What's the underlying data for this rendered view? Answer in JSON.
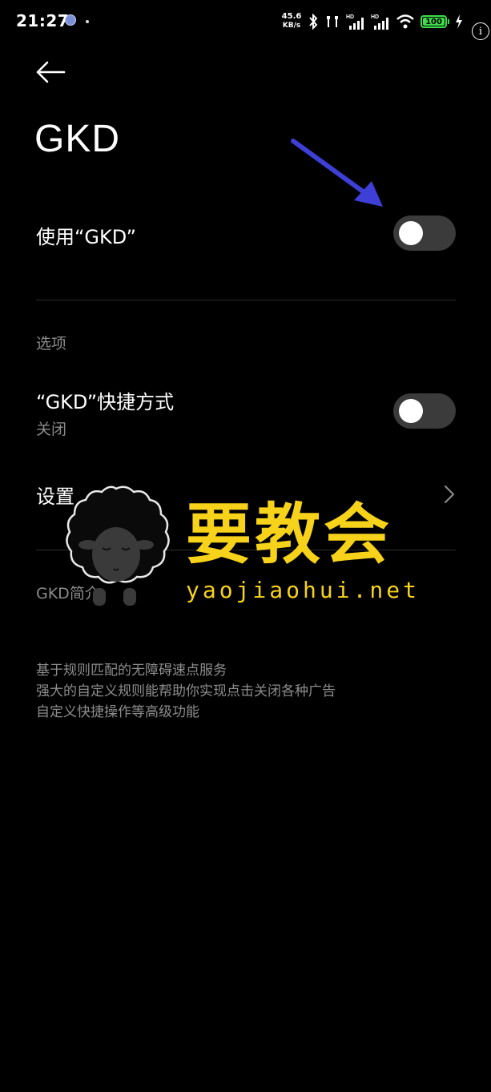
{
  "status_bar": {
    "time": "21:27",
    "net_speed_value": "45.6",
    "net_speed_unit": "KB/s",
    "battery": "100",
    "icons": [
      "bluetooth-icon",
      "earbuds-icon",
      "signal-hd-icon",
      "signal-hd-icon",
      "wifi-icon",
      "battery-icon",
      "charging-icon"
    ]
  },
  "header": {
    "back_icon": "arrow-left-icon",
    "title": "GKD"
  },
  "settings": {
    "use_gkd": {
      "label": "使用“GKD”",
      "enabled": false
    },
    "options_header": "选项",
    "shortcut": {
      "label": "“GKD”快捷方式",
      "status": "关闭",
      "enabled": false
    },
    "settings_item": {
      "label": "设置"
    },
    "intro_header": "GKD简介"
  },
  "description": [
    "基于规则匹配的无障碍速点服务",
    "强大的自定义规则能帮助你实现点击关闭各种广告",
    "自定义快捷操作等高级功能"
  ],
  "watermark": {
    "title": "要教会",
    "url": "yaojiaohui.net"
  },
  "colors": {
    "background": "#000000",
    "toggle_off": "#3b3b3b",
    "annotation_arrow": "#3d3fd6",
    "watermark": "#f7d21a",
    "battery": "#3ddc4b"
  }
}
